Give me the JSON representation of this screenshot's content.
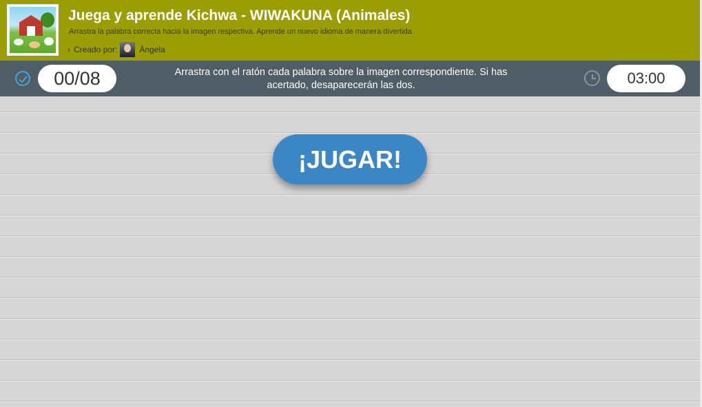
{
  "header": {
    "title": "Juega y aprende Kichwa - WIWAKUNA (Animales)",
    "subtitle": "Arrastra la palabra correcta hacia la imagen respectiva. Aprende un nuevo idioma de manera divertida",
    "created_by_label": "Creado por:",
    "author_name": "Àngela"
  },
  "status_bar": {
    "score": "00/08",
    "instructions": "Arrastra con el ratón cada palabra sobre la imagen correspondiente. Si has acertado, desaparecerán las dos.",
    "timer": "03:00"
  },
  "game": {
    "play_label": "¡JUGAR!"
  },
  "colors": {
    "header_bg": "#9b9e00",
    "bar_bg": "#4f5d66",
    "button_bg": "#3b86c4",
    "board_bg": "#d6d6d6"
  }
}
